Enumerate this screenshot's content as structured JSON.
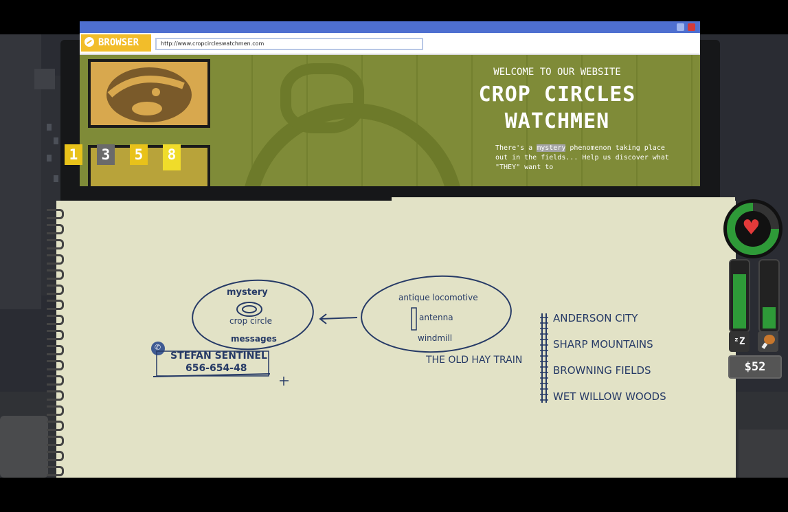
{
  "browser": {
    "app_name": "BROWSER",
    "url": "http://www.cropcircleswatchmen.com",
    "site": {
      "welcome": "WELCOME TO OUR WEBSITE",
      "title_line1": "CROP CIRCLES",
      "title_line2": "WATCHMEN",
      "intro_before": "There's a ",
      "intro_highlight": "mystery",
      "intro_after": " phenomenon taking place out in the fields... Help us discover what \"THEY\" want to"
    }
  },
  "tabs": [
    {
      "label": "1",
      "color": "#e8c21a"
    },
    {
      "label": "3",
      "color": "#6a6a6a"
    },
    {
      "label": "5",
      "color": "#e8c21a"
    },
    {
      "label": "8",
      "color": "#f0dc2a"
    }
  ],
  "notes": {
    "cluster1": {
      "top": "mystery",
      "middle": "crop circle",
      "bottom": "messages"
    },
    "cluster2": {
      "top": "antique locomotive",
      "middle": "antenna",
      "bottom": "windmill",
      "caption": "THE OLD HAY TRAIN"
    },
    "contact": {
      "name": "STEFAN SENTINEL",
      "phone": "656-654-48"
    },
    "locations": [
      "ANDERSON CITY",
      "SHARP MOUNTAINS",
      "BROWNING FIELDS",
      "WET WILLOW WOODS"
    ]
  },
  "hud": {
    "health_icon": "heart-icon",
    "sleep_icon": "zzz-icon",
    "hunger_icon": "drumstick-icon",
    "sleep_level": 0.83,
    "hunger_level": 0.33,
    "money": "$52",
    "colors": {
      "bar": "#2e9a38",
      "accent": "#e8c21a"
    }
  }
}
